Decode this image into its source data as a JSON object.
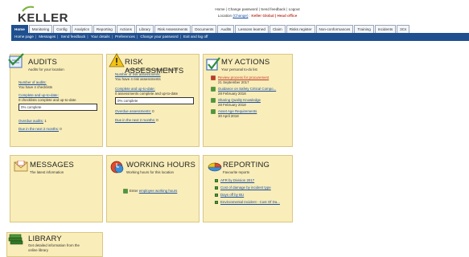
{
  "brand": {
    "name": "KELLER"
  },
  "toplinks": {
    "home": "Home",
    "change_password": "Change password",
    "send_feedback": "Send feedback",
    "logout": "Logout",
    "location_label": "Location",
    "location_change": "(Change)",
    "location_value": "Keller Global | Head office"
  },
  "tabs": [
    "Home",
    "Monitoring",
    "Config",
    "Analytics",
    "Reporting",
    "Actions",
    "Library",
    "Risk Assessments",
    "Documents",
    "Audits",
    "Lessons learned",
    "Claim",
    "Risks register",
    "Non-conformances",
    "Training",
    "Incidents",
    "3Cs"
  ],
  "subnav": [
    "Home page",
    "Messages",
    "Send feedback",
    "Your details",
    "Preferences",
    "Change your password",
    "Exit and log off"
  ],
  "audits": {
    "title": "AUDITS",
    "subtitle": "Audits for your location",
    "number_link": "Number of audits:",
    "number_text": "You have 4 checklists",
    "complete_link": "Complete and up-to-date:",
    "complete_text": "0 checklists complete and up-to-date",
    "progress": "0% complete",
    "progress_fraction": 0,
    "overdue_link": "Overdue audits:",
    "overdue_value": "1",
    "due_link": "Due in the next 2 months:",
    "due_value": "0"
  },
  "risk": {
    "title": "RISK ASSESSMENTS",
    "subtitle": "Analyse the risks at your location",
    "number_link": "Number of risk assessments:",
    "number_text": "You have 4 risk assessments",
    "complete_link": "Complete and up-to-date:",
    "complete_text": "0 assessments complete and up-to-date",
    "progress": "0% complete",
    "progress_fraction": 0,
    "overdue_link": "Overdue assessments:",
    "overdue_value": "0",
    "due_link": "Due in the next 2 months:",
    "due_value": "0"
  },
  "actions": {
    "title": "MY ACTIONS",
    "subtitle": "Your personal to-do list",
    "items": [
      {
        "label": "Review process for procurement",
        "date": "21 September 2017",
        "overdue": true
      },
      {
        "label": "Guidance on Safety Critical Compo...",
        "date": "28 February 2018",
        "overdue": false
      },
      {
        "label": "Sharing Quality Knowledge",
        "date": "28 February 2018",
        "overdue": false
      },
      {
        "label": "Asset Age Requirements",
        "date": "30 April 2018",
        "overdue": false
      }
    ]
  },
  "messages": {
    "title": "MESSAGES",
    "subtitle": "The latest information"
  },
  "working_hours": {
    "title": "WORKING HOURS",
    "subtitle": "Working hours for this location",
    "enter_prefix": "Enter",
    "enter_link": "employee working hours"
  },
  "reporting": {
    "title": "REPORTING",
    "subtitle": "Favourite reports",
    "items": [
      "AFR by Division 2017",
      "Cost of damage by incident type",
      "Days off by BU",
      "Environmental Incident - Cost Of Da..."
    ]
  },
  "library": {
    "title": "LIBRARY",
    "subtitle_line1": "Get detailed information from the",
    "subtitle_line2": "online library"
  },
  "colors": {
    "panel_bg": "#f9edb9",
    "nav_blue": "#1f4f8f",
    "link_blue": "#1a4fa0",
    "alert_red": "#c0392b"
  }
}
